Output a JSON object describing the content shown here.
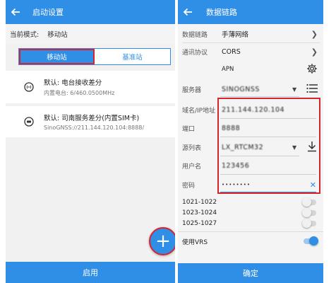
{
  "left": {
    "title": "启动设置",
    "mode_label": "当前模式:",
    "mode_value": "移动站",
    "tabs": [
      "移动站",
      "基准站"
    ],
    "card1": {
      "title": "默认: 电台接收差分",
      "subtitle": "内置电台: 6/460.0500MHz"
    },
    "card2": {
      "title": "默认: 司南服务差分(内置SIM卡)",
      "subtitle": "SinoGNSS://211.144.120.104:8888/"
    },
    "enable_label": "启用",
    "fab_icon": "+"
  },
  "right": {
    "title": "数据链路",
    "link_label": "数据链路",
    "link_value": "手薄网络",
    "protocol_label": "通讯协议",
    "protocol_value": "CORS",
    "apn_label": "APN",
    "server_label": "服务器",
    "server_value": "SINOGNSS",
    "domain_label": "域名/IP地址",
    "domain_value": "211.144.120.104",
    "port_label": "端口",
    "port_value": "8888",
    "source_label": "源列表",
    "source_value": "LX_RTCM32",
    "user_label": "用户名",
    "user_value": "123456",
    "password_label": "密码",
    "password_value": "••••••••",
    "msg_items": [
      {
        "label": "1021-1022",
        "on": false
      },
      {
        "label": "1023-1024",
        "on": false
      },
      {
        "label": "1025-1027",
        "on": false
      }
    ],
    "vrs_label": "使用VRS",
    "vrs_on": true,
    "confirm_label": "确定"
  },
  "colors": {
    "primary": "#2f8ee6",
    "highlight": "#d9232d"
  }
}
